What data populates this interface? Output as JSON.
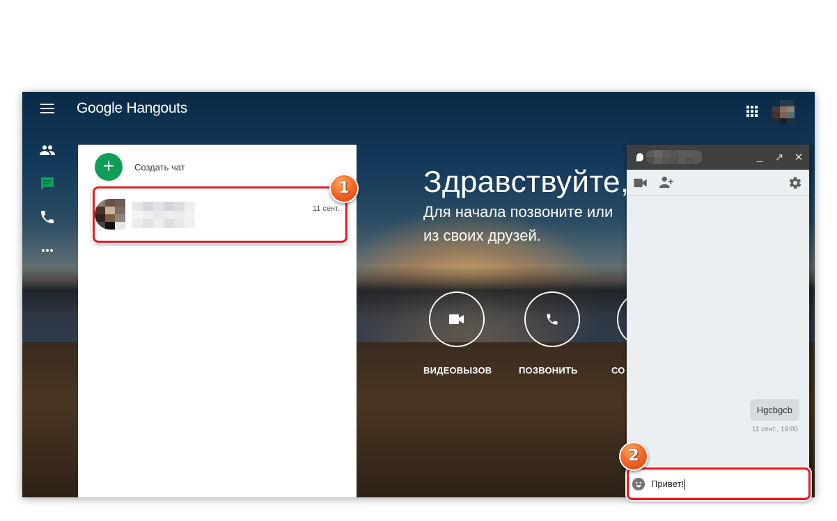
{
  "app": {
    "brand_google": "Google",
    "brand_product": "Hangouts"
  },
  "rail": {
    "items": [
      {
        "name": "contacts",
        "icon": "people-icon",
        "active": false
      },
      {
        "name": "conversations",
        "icon": "chat-icon",
        "active": true
      },
      {
        "name": "phone-calls",
        "icon": "phone-icon",
        "active": false
      },
      {
        "name": "more",
        "icon": "more-horiz-icon",
        "active": false
      }
    ],
    "active_color": "#0f9d58"
  },
  "conversations": {
    "new_chat_label": "Создать чат",
    "items": [
      {
        "name": "[blurred]",
        "preview": "[blurred]",
        "date": "11 сент."
      }
    ]
  },
  "welcome": {
    "title": "Здравствуйте,",
    "subtitle_line1": "Для начала позвоните или",
    "subtitle_line2": "из своих друзей.",
    "actions": [
      {
        "label": "ВИДЕОВЫЗОВ",
        "icon": "videocam-icon"
      },
      {
        "label": "ПОЗВОНИТЬ",
        "icon": "phone-icon"
      },
      {
        "label": "СО",
        "icon": "chat-icon"
      }
    ]
  },
  "chat_window": {
    "contact_name": "[blurred]",
    "controls": {
      "minimize": "_",
      "popout": "↗",
      "close": "✕"
    },
    "messages": [
      {
        "text": "Hgcbgcb",
        "time": "11 сент., 19:00",
        "outgoing": true
      }
    ],
    "input_value": "Привет!",
    "input_placeholder": ""
  },
  "annotations": [
    {
      "number": "1",
      "target": "conversation-item"
    },
    {
      "number": "2",
      "target": "message-input"
    }
  ],
  "colors": {
    "accent_green": "#0f9d58",
    "highlight_red": "#e21b22",
    "chat_header": "#404040",
    "chat_bg": "#eceff1"
  }
}
